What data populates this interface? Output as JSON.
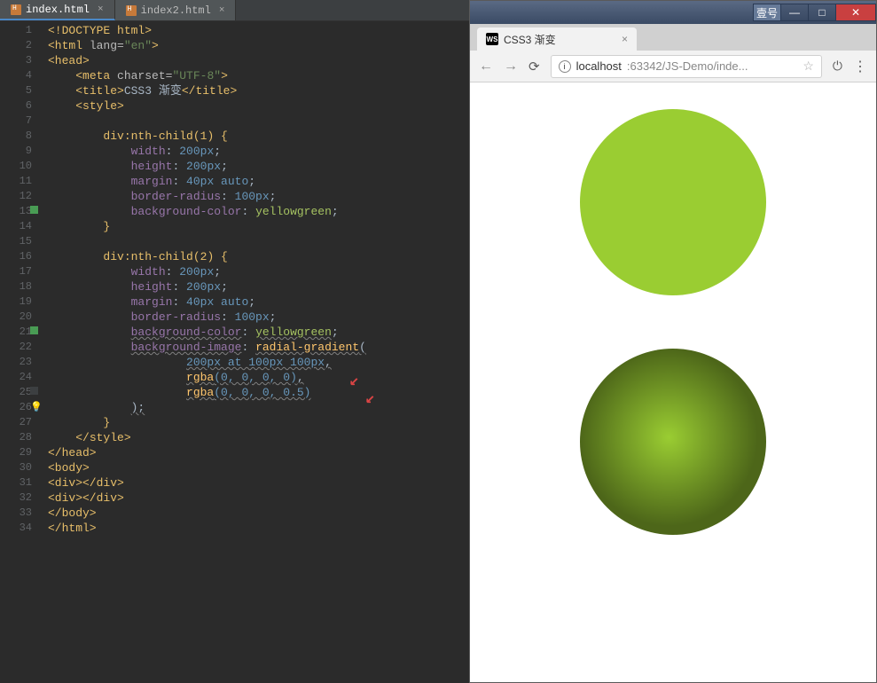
{
  "editor": {
    "tabs": [
      {
        "label": "index.html",
        "active": true
      },
      {
        "label": "index2.html",
        "active": false
      }
    ],
    "line_numbers": [
      "1",
      "2",
      "3",
      "4",
      "5",
      "6",
      "7",
      "8",
      "9",
      "10",
      "11",
      "12",
      "13",
      "14",
      "15",
      "16",
      "17",
      "18",
      "19",
      "20",
      "21",
      "22",
      "23",
      "24",
      "25",
      "26",
      "27",
      "28",
      "29",
      "30",
      "31",
      "32",
      "33",
      "34"
    ],
    "code": {
      "l1": "<!DOCTYPE html>",
      "l2_open": "<html ",
      "l2_attr": "lang=",
      "l2_val": "\"en\"",
      "l2_close": ">",
      "l3": "<head>",
      "l4_a": "<meta ",
      "l4_b": "charset=",
      "l4_c": "\"UTF-8\"",
      "l4_d": ">",
      "l5_a": "<title>",
      "l5_b": "CSS3 渐变",
      "l5_c": "</title>",
      "l6": "<style>",
      "l8_sel": "div:nth-child",
      "l8_paren": "(1) {",
      "l9_p": "width",
      "l9_v": "200px",
      "l10_p": "height",
      "l10_v": "200px",
      "l11_p": "margin",
      "l11_v": "40px auto",
      "l12_p": "border-radius",
      "l12_v": "100px",
      "l13_p": "background-color",
      "l13_v": "yellowgreen",
      "l14": "}",
      "l16_sel": "div:nth-child",
      "l16_paren": "(2) {",
      "l17_p": "width",
      "l17_v": "200px",
      "l18_p": "height",
      "l18_v": "200px",
      "l19_p": "margin",
      "l19_v": "40px auto",
      "l20_p": "border-radius",
      "l20_v": "100px",
      "l21_p": "background-color",
      "l21_v": "yellowgreen",
      "l22_p": "background-image",
      "l22_fn": "radial-gradient",
      "l23": "200px at 100px 100px",
      "l24_fn": "rgba",
      "l24_args": "(0, 0, 0, 0)",
      "l25_fn": "rgba",
      "l25_args": "(0, 0, 0, 0.5)",
      "l26": ");",
      "l27": "}",
      "l28": "</style>",
      "l29": "</head>",
      "l30": "<body>",
      "l31": "<div></div>",
      "l32": "<div></div>",
      "l33": "</body>",
      "l34": "</html>"
    }
  },
  "browser": {
    "win_title": "",
    "win_tag": "壹号",
    "tab_title": "CSS3 渐变",
    "url_host": "localhost",
    "url_port": ":63342",
    "url_path": "/JS-Demo/inde..."
  }
}
